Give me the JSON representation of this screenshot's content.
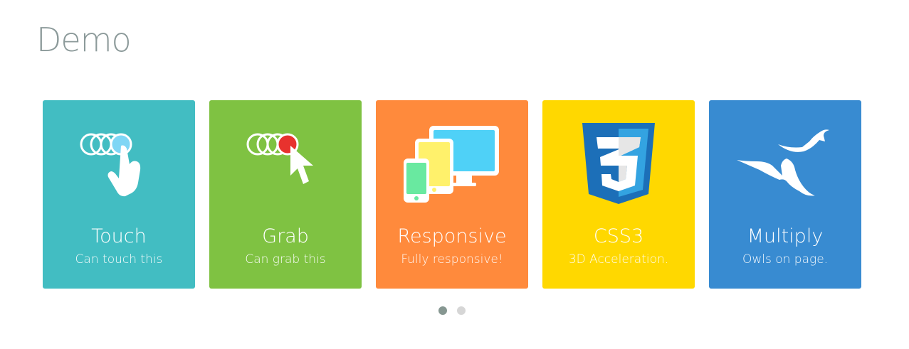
{
  "page": {
    "title": "Demo"
  },
  "cards": [
    {
      "title": "Touch",
      "subtitle": "Can touch this",
      "color": "#42bdc2",
      "icon": "touch-gesture-icon"
    },
    {
      "title": "Grab",
      "subtitle": "Can grab this",
      "color": "#7fc242",
      "icon": "grab-cursor-icon"
    },
    {
      "title": "Responsive",
      "subtitle": "Fully responsive!",
      "color": "#ff8a3c",
      "icon": "devices-icon"
    },
    {
      "title": "CSS3",
      "subtitle": "3D Acceleration.",
      "color": "#ffd800",
      "icon": "css3-logo-icon"
    },
    {
      "title": "Multiply",
      "subtitle": "Owls on page.",
      "color": "#388bd1",
      "icon": "birds-icon"
    }
  ],
  "pagination": {
    "pages": 2,
    "active_index": 0,
    "active_color": "#869791",
    "inactive_color": "#d6d6d6"
  }
}
